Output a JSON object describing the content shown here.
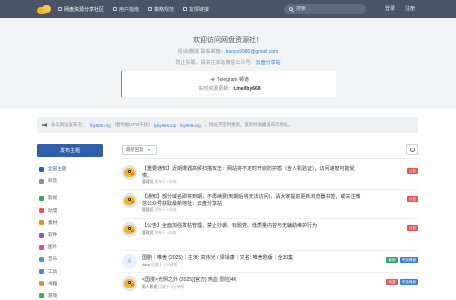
{
  "nav": {
    "items": [
      {
        "label": "网盘资源分享社区",
        "active": true
      },
      {
        "label": "用户指南",
        "active": false
      },
      {
        "label": "策略规范",
        "active": false
      },
      {
        "label": "友情链接",
        "active": false
      }
    ],
    "search_placeholder": "搜索",
    "login": "登录",
    "register": "注册"
  },
  "hero": {
    "title": "欢迎访问网盘资源社！",
    "contact_label": "投诉/删除 联系邮箱：",
    "contact_email": "baoyu9980@gmail.com",
    "wechat_label": "防止失联，请关注本站微信公众号：",
    "wechat_value": "云盘分享站",
    "telegram_title": "Telegram 频道",
    "telegram_sub_label": "实时资源更新：",
    "telegram_handle": "t.me/lby668"
  },
  "notice": {
    "prefix": "永久网址发布页：",
    "site1": "lby668.org",
    "mid1": "(暂时被GFW干扰)",
    "site2": "lyby666.top",
    "site3": "lby999.org",
    "suffix": "，网址不定时更新，请及时收藏发布页地址。"
  },
  "sidebar": {
    "post_button": "发布主题",
    "items": [
      {
        "label": "全部主题",
        "color": "#2e5fa8",
        "active": true
      },
      {
        "label": "标签",
        "color": "#8a8f98",
        "active": false
      },
      {
        "label": "影视",
        "color": "#3aa35f",
        "active": false
      },
      {
        "label": "动漫",
        "color": "#e25656",
        "active": false
      },
      {
        "label": "素材",
        "color": "#e0912c",
        "active": false
      },
      {
        "label": "软件",
        "color": "#7a5bd6",
        "active": false
      },
      {
        "label": "图片",
        "color": "#d64a9a",
        "active": false
      },
      {
        "label": "音乐",
        "color": "#2fa6b8",
        "active": false
      },
      {
        "label": "工具",
        "color": "#5c7ad8",
        "active": false
      },
      {
        "label": "书籍",
        "color": "#c9a227",
        "active": false
      },
      {
        "label": "游戏",
        "color": "#4ca64c",
        "active": false
      }
    ]
  },
  "main": {
    "filter_label": "最新回复",
    "posts": [
      {
        "avatar": "bird",
        "title": "【重要通知】近期遭遇高频扫描攻击：网站将不定时开启防护盾（含人机验证），访问速度可能受慢。",
        "user": "管理员",
        "time": "发布于 1年前",
        "badges": [
          {
            "label": "公告",
            "color": "#e25656"
          }
        ]
      },
      {
        "avatar": "bird",
        "title": "【通知】部分域名即将到期，不再续费(到期后将无法访问)，请大家提前更新浏览器书签，或关注微信公众号获取最新地址：云盘分享站",
        "user": "管理员",
        "time": "发布于 1年前",
        "badges": [
          {
            "label": "公告",
            "color": "#e25656"
          }
        ]
      },
      {
        "avatar": "bird",
        "title": "【公告】全面加强发帖管理，禁止抄袭、标题党、低质量内容与无辅助维护行为",
        "user": "管理员",
        "time": "发布于 4年前",
        "badges": [
          {
            "label": "公告",
            "color": "#e25656"
          }
        ]
      },
      {
        "avatar": "A",
        "title": "国剧｜唯舍 (2025)｜主演: 高伟光 / 梁靖康｜又名: 唯舍剧版｜全30集",
        "user": "Alice",
        "time": "回复于 1分钟前",
        "badges": [
          {
            "label": "影视",
            "color": "#3aa35f"
          },
          {
            "label": "夸克网盘",
            "color": "#3b7fd6"
          }
        ]
      },
      {
        "avatar": "bird",
        "title": "<国漫>光阴之外 (2025)[官方] 热血 冒险]4K",
        "user": "雨人影视",
        "time": "回复于 3分钟前",
        "badges": [
          {
            "label": "动漫",
            "color": "#e25656"
          },
          {
            "label": "夸克网盘",
            "color": "#3b7fd6"
          }
        ]
      }
    ]
  }
}
